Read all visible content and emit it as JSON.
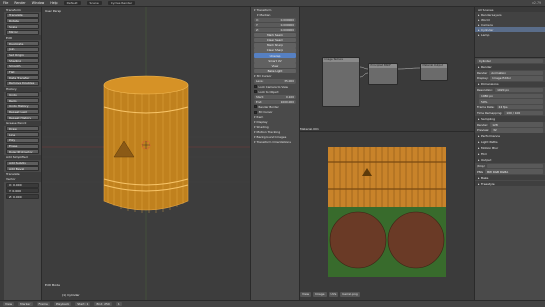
{
  "topbar": {
    "menus": [
      "File",
      "Render",
      "Window",
      "Help"
    ],
    "layout": "Default",
    "scene": "Scene",
    "engine": "Cycles Render",
    "version": "v2.79"
  },
  "toolshelf": {
    "sections": [
      {
        "title": "Transform",
        "items": [
          "Translate",
          "Rotate",
          "Scale",
          "Mirror"
        ]
      },
      {
        "title": "Edit",
        "items": [
          "Duplicate",
          "Join",
          "Set Origin",
          "Shading",
          "Smooth",
          "Flat",
          "Data Transfer",
          "Remove Doubles"
        ]
      },
      {
        "title": "History",
        "items": [
          "Undo",
          "Redo",
          "Undo History",
          "Repeat Last",
          "Repeat History"
        ]
      },
      {
        "title": "Grease Pencil",
        "items": [
          "Draw",
          "Line",
          "Poly",
          "Erase",
          "Ruler/Protractor"
        ]
      },
      {
        "title": "Add Simplified",
        "items": [
          "Add Subdiv",
          "Add Bevel"
        ]
      }
    ],
    "bottom_labels": [
      "Translate",
      "Vector"
    ],
    "bottom_values": [
      "X: 0.000",
      "Y: 0.000",
      "Z: 0.000"
    ]
  },
  "viewport": {
    "title": "User Persp",
    "object_label": "(1) Cylinder",
    "mode_label": "Edit Mode",
    "bottom_buttons": [
      "View",
      "Select",
      "Mesh",
      "Edit Mode",
      "Global"
    ]
  },
  "midprops": {
    "sections": [
      "Transform",
      "Median",
      "3D Cursor",
      "Item",
      "Display",
      "Shading",
      "Motion Tracking",
      "Background Images",
      "Transform Orientations"
    ],
    "values": [
      {
        "label": "X:",
        "value": "0.000000"
      },
      {
        "label": "Y:",
        "value": "0.000000"
      },
      {
        "label": "Z:",
        "value": "0.000000"
      }
    ],
    "buttons": [
      "Mark Seam",
      "Clear Seam",
      "Mark Sharp",
      "Clear Sharp",
      "Unwrap",
      "Smart UV",
      "View",
      "Bake Light"
    ],
    "lens_label": "Lens:",
    "lens_value": "35.000",
    "clip_start_label": "Start:",
    "clip_start_value": "0.100",
    "clip_end_label": "End:",
    "clip_end_value": "1000.000",
    "checks": [
      "Lock Camera to View",
      "Lock to Object",
      "Render Border",
      "3D Cursor"
    ]
  },
  "nodeeditor": {
    "material_label": "Material.001",
    "nodes": [
      {
        "name": "Image Texture"
      },
      {
        "name": "Principled BSDF"
      },
      {
        "name": "Material Output"
      }
    ]
  },
  "imageeditor": {
    "buttons": [
      "View",
      "Image",
      "UVs",
      "barrel.png"
    ],
    "image_name": "barrel.png"
  },
  "outliner": {
    "search_label": "All Scenes",
    "rows": [
      {
        "label": "RenderLayers",
        "sel": false
      },
      {
        "label": "World",
        "sel": false
      },
      {
        "label": "Camera",
        "sel": false
      },
      {
        "label": "Cylinder",
        "sel": true
      },
      {
        "label": "Lamp",
        "sel": false
      }
    ]
  },
  "props": {
    "object_name": "Cylinder",
    "panels": [
      {
        "title": "Render",
        "rows": [
          [
            "Render",
            "Animation"
          ],
          [
            "Display:",
            "Image Editor"
          ]
        ]
      },
      {
        "title": "Dimensions",
        "rows": [
          [
            "Resolution:",
            "1920 px"
          ],
          [
            "",
            "1080 px"
          ],
          [
            "",
            "50%"
          ],
          [
            "Frame Rate:",
            "24 fps"
          ],
          [
            "Time Remapping:",
            "100 / 100"
          ]
        ]
      },
      {
        "title": "Sampling",
        "rows": [
          [
            "Render:",
            "128"
          ],
          [
            "Preview:",
            "32"
          ]
        ]
      },
      {
        "title": "Performance",
        "rows": []
      },
      {
        "title": "Light Paths",
        "rows": []
      },
      {
        "title": "Motion Blur",
        "rows": []
      },
      {
        "title": "Film",
        "rows": []
      },
      {
        "title": "Output",
        "rows": [
          [
            "/tmp/",
            ""
          ],
          [
            "PNG",
            "BW RGB RGBA"
          ]
        ]
      },
      {
        "title": "Bake",
        "rows": []
      },
      {
        "title": "Freestyle",
        "rows": []
      }
    ]
  },
  "bottombar": {
    "items": [
      "View",
      "Marker",
      "Frame",
      "Playback",
      "Start: 1",
      "End: 250",
      "1"
    ]
  }
}
